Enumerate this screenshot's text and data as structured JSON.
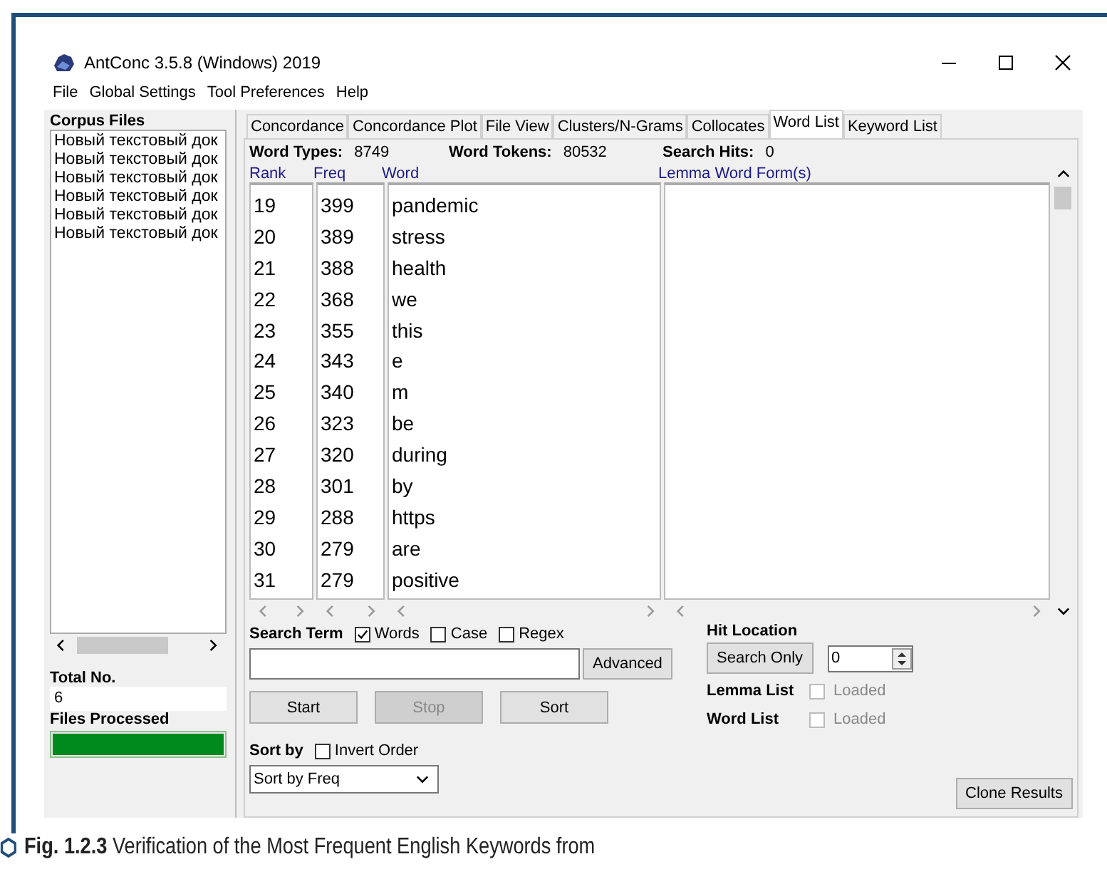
{
  "window": {
    "title": "AntConc 3.5.8 (Windows) 2019"
  },
  "menu": [
    "File",
    "Global Settings",
    "Tool Preferences",
    "Help"
  ],
  "corpus_files": {
    "label": "Corpus Files",
    "items": [
      "Новый текстовый док",
      "Новый текстовый док",
      "Новый текстовый док",
      "Новый текстовый док",
      "Новый текстовый док",
      "Новый текстовый док"
    ]
  },
  "total_no": {
    "label": "Total No.",
    "value": "6"
  },
  "files_processed": {
    "label": "Files Processed",
    "level": 1
  },
  "tabs": [
    {
      "label": "Concordance",
      "selected": false
    },
    {
      "label": "Concordance Plot",
      "selected": false
    },
    {
      "label": "File View",
      "selected": false
    },
    {
      "label": "Clusters/N-Grams",
      "selected": false
    },
    {
      "label": "Collocates",
      "selected": false
    },
    {
      "label": "Word List",
      "selected": true
    },
    {
      "label": "Keyword List",
      "selected": false
    }
  ],
  "stats": [
    {
      "label": "Word Types:",
      "value": "8749"
    },
    {
      "label": "Word Tokens:",
      "value": "80532"
    },
    {
      "label": "Search Hits:",
      "value": "0"
    }
  ],
  "columns": [
    "Rank",
    "Freq",
    "Word",
    "Lemma Word Form(s)"
  ],
  "rows": [
    {
      "rank": "19",
      "freq": "399",
      "word": "pandemic"
    },
    {
      "rank": "20",
      "freq": "389",
      "word": "stress"
    },
    {
      "rank": "21",
      "freq": "388",
      "word": "health"
    },
    {
      "rank": "22",
      "freq": "368",
      "word": "we"
    },
    {
      "rank": "23",
      "freq": "355",
      "word": "this"
    },
    {
      "rank": "24",
      "freq": "343",
      "word": "e"
    },
    {
      "rank": "25",
      "freq": "340",
      "word": "m"
    },
    {
      "rank": "26",
      "freq": "323",
      "word": "be"
    },
    {
      "rank": "27",
      "freq": "320",
      "word": "during"
    },
    {
      "rank": "28",
      "freq": "301",
      "word": "by"
    },
    {
      "rank": "29",
      "freq": "288",
      "word": "https"
    },
    {
      "rank": "30",
      "freq": "279",
      "word": "are"
    },
    {
      "rank": "31",
      "freq": "279",
      "word": "positive"
    }
  ],
  "search": {
    "label": "Search Term",
    "options": [
      {
        "label": "Words",
        "checked": true
      },
      {
        "label": "Case",
        "checked": false
      },
      {
        "label": "Regex",
        "checked": false
      }
    ],
    "advanced": "Advanced"
  },
  "buttons": [
    {
      "label": "Start",
      "disabled": false
    },
    {
      "label": "Stop",
      "disabled": true
    },
    {
      "label": "Sort",
      "disabled": false
    }
  ],
  "sort": {
    "label": "Sort by",
    "invert": {
      "label": "Invert Order",
      "checked": false
    },
    "value": "Sort by Freq"
  },
  "hit_location": {
    "label": "Hit Location",
    "button": "Search Only",
    "value": "0"
  },
  "loaded": [
    {
      "label": "Lemma List",
      "status": "Loaded",
      "checked": false
    },
    {
      "label": "Word List",
      "status": "Loaded",
      "checked": false
    }
  ],
  "clone_button": "Clone Results",
  "caption": {
    "number": "Fig. 1.2.3",
    "text": "Verification of the Most Frequent English Keywords from"
  }
}
